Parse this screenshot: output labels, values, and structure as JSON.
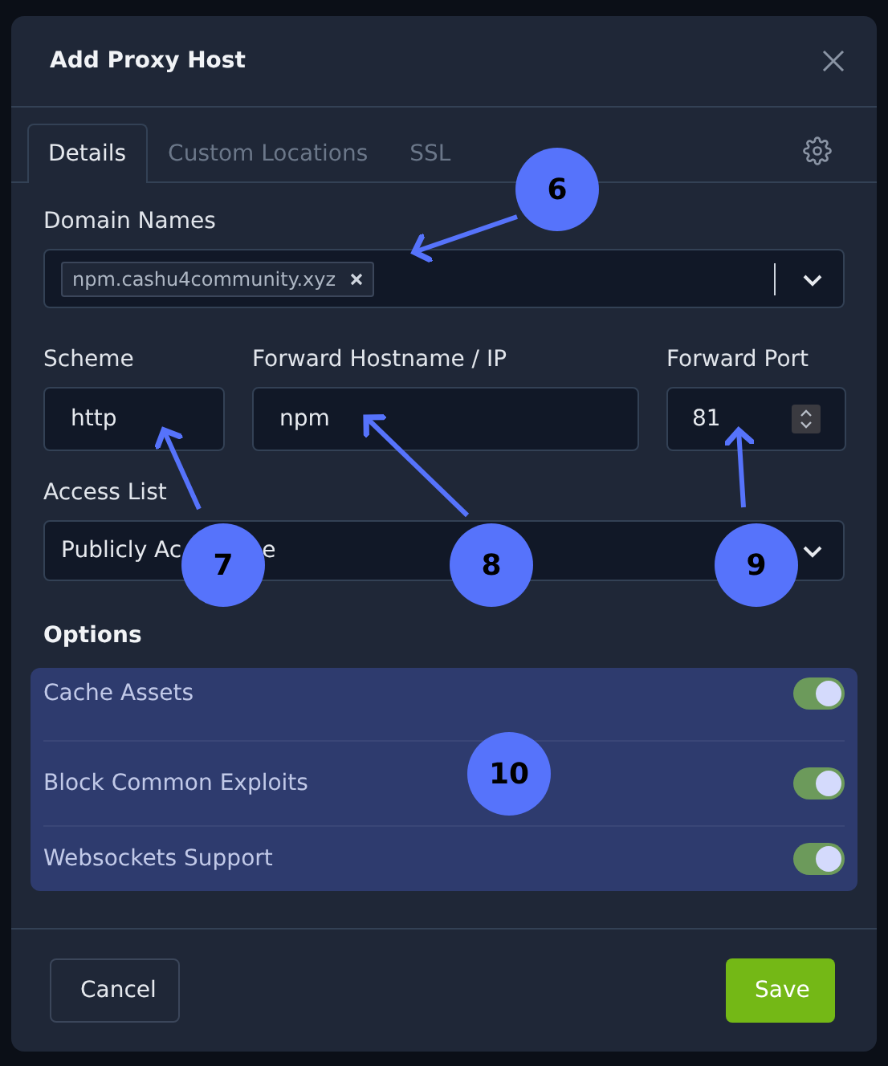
{
  "dialog": {
    "title": "Add Proxy Host"
  },
  "tabs": [
    {
      "label": "Details",
      "selected": true
    },
    {
      "label": "Custom Locations",
      "selected": false
    },
    {
      "label": "SSL",
      "selected": false
    }
  ],
  "domain_names": {
    "label": "Domain Names",
    "chips": [
      "npm.cashu4community.xyz"
    ]
  },
  "scheme": {
    "label": "Scheme",
    "value": "http"
  },
  "forward_hostname": {
    "label": "Forward Hostname / IP",
    "value": "npm"
  },
  "forward_port": {
    "label": "Forward Port",
    "value": "81"
  },
  "access_list": {
    "label": "Access List",
    "value": "Publicly Ac",
    "value_end": "e"
  },
  "options": {
    "title": "Options",
    "items": [
      {
        "label": "Cache Assets",
        "on": true
      },
      {
        "label": "Block Common Exploits",
        "on": true
      },
      {
        "label": "Websockets Support",
        "on": true
      }
    ]
  },
  "buttons": {
    "cancel": "Cancel",
    "save": "Save"
  },
  "annotations": [
    "6",
    "7",
    "8",
    "9",
    "10"
  ]
}
